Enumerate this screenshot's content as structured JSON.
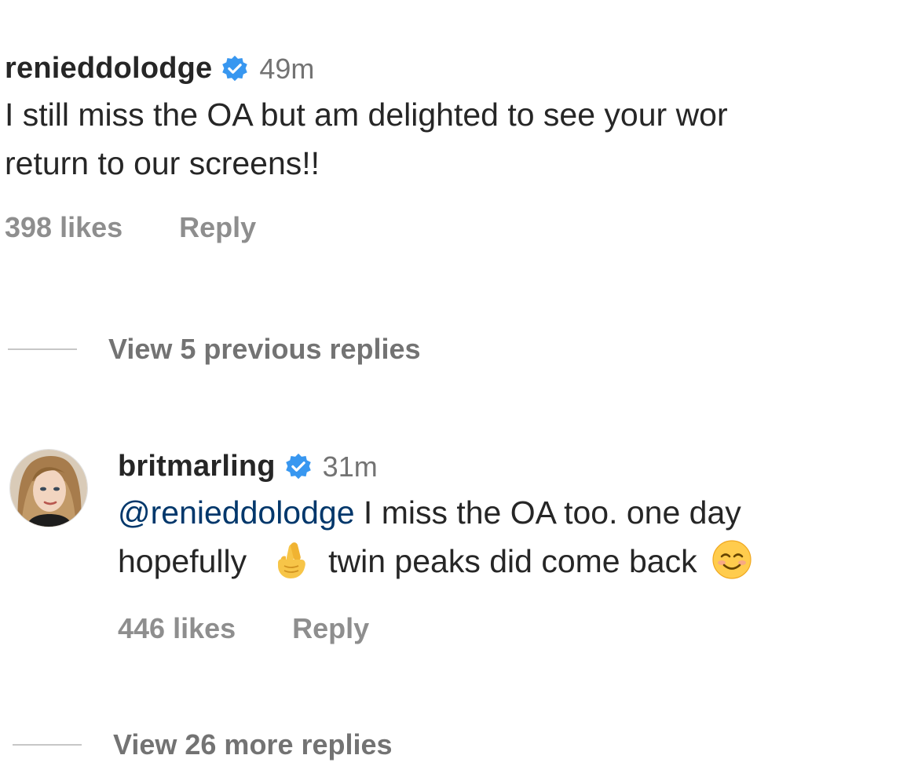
{
  "comment1": {
    "username": "renieddolodge",
    "verified_icon": "verified-badge-icon",
    "timestamp": "49m",
    "text_line1": "I still miss the OA but am delighted to see your wor",
    "text_line2": "return to our screens!!",
    "likes": "398 likes",
    "reply_label": "Reply"
  },
  "view_previous": {
    "label": "View 5 previous replies"
  },
  "comment2": {
    "username": "britmarling",
    "verified_icon": "verified-badge-icon",
    "timestamp": "31m",
    "mention": "@renieddolodge",
    "text_line1_rest": " I miss the OA too. one day",
    "text_line2_part1": "hopefully",
    "emoji1": "crossed-fingers-emoji",
    "text_line2_part2": "twin peaks did come back",
    "emoji2": "smiling-face-emoji",
    "likes": "446 likes",
    "reply_label": "Reply"
  },
  "view_more": {
    "label": "View 26 more replies"
  },
  "colors": {
    "text": "#262626",
    "secondary": "#8e8e8e",
    "verified": "#3897f0",
    "mention": "#00376b"
  }
}
